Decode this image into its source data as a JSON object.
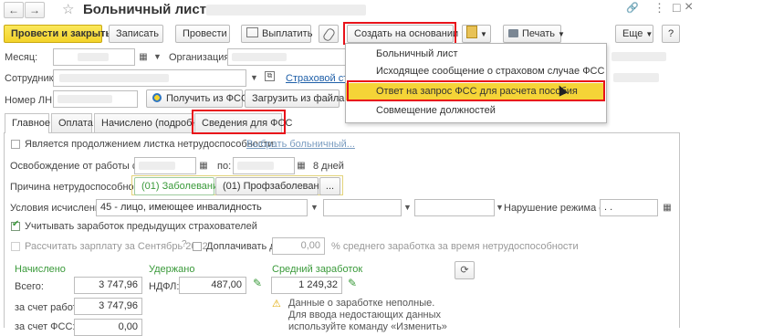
{
  "window": {
    "title": "Больничный лист",
    "nav_back": "←",
    "nav_fwd": "→",
    "star": "☆",
    "link_icon": "🔗",
    "more": "⋮",
    "maximize": "□",
    "close": "×"
  },
  "toolbar": {
    "post_close": "Провести и закрыть",
    "save": "Записать",
    "post": "Провести",
    "pay": "Выплатить",
    "create_based_on": "Создать на основании",
    "print": "Печать",
    "more": "Еще",
    "help": "?"
  },
  "menu": {
    "items": [
      "Больничный лист",
      "Исходящее сообщение о страховом случае ФСС",
      "Ответ на запрос ФСС для расчета пособия",
      "Совмещение должностей"
    ]
  },
  "header": {
    "month_label": "Месяц:",
    "org_label": "Организация:",
    "employee_label": "Сотрудник:",
    "insurance_link": "Страховой стаж",
    "ln_number_label": "Номер ЛН:",
    "get_from_fss": "Получить из ФСС",
    "load_from_file": "Загрузить из файла"
  },
  "tabs": [
    "Главное",
    "Оплата",
    "Начислено (подробно)",
    "Сведения для ФСС"
  ],
  "main": {
    "continuation_label": "Является продолжением листка нетрудоспособности:",
    "choose_sick_leave": "Выбрать больничный...",
    "release_label": "Освобождение от работы с:",
    "release_to_label": "по:",
    "days": "8 дней",
    "cause_label": "Причина нетрудоспособности:",
    "cause_disease": "(01) Заболевание",
    "cause_occupational": "(01) Профзаболевание",
    "cause_more": "...",
    "conditions_label": "Условия исчисления:",
    "conditions_value": "45 - лицо, имеющее инвалидность",
    "violation_label": "Нарушение режима с:",
    "violation_value": ". .",
    "consider_earnings_label": "Учитывать заработок предыдущих страхователей",
    "calc_salary_label": "Рассчитать зарплату за Сентябрь 2022",
    "add_up_to_label": "Доплачивать до",
    "add_up_to_value": "0,00",
    "percent_label": "% среднего заработка за время нетрудоспособности"
  },
  "totals": {
    "accrued_header": "Начислено",
    "withheld_header": "Удержано",
    "avg_header": "Средний заработок",
    "total_label": "Всего:",
    "total_value": "3 747,96",
    "employer_label": "за счет работ.:",
    "employer_value": "3 747,96",
    "fss_label": "за счет ФСС:",
    "fss_value": "0,00",
    "ndfl_label": "НДФЛ:",
    "ndfl_value": "487,00",
    "avg_value": "1 249,32",
    "warning_lines": [
      "Данные о заработке неполные.",
      "Для ввода недостающих данных",
      "используйте команду «Изменить»"
    ]
  },
  "colors": {
    "accent_yellow": "#f3d32b",
    "highlight_red": "#e8121a",
    "menu_highlight": "#f5d437",
    "link_blue": "#1e5fa8",
    "green_label": "#3a9a3a"
  }
}
